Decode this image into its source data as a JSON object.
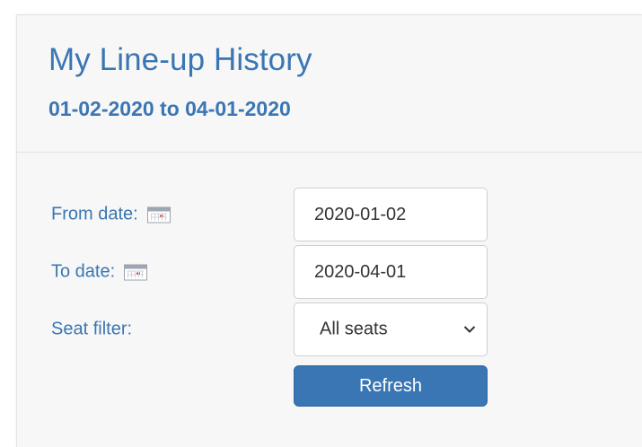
{
  "page": {
    "title": "My Line-up History",
    "subtitle": "01-02-2020 to 04-01-2020"
  },
  "filters": {
    "from_date": {
      "label": "From date:",
      "value": "2020-01-02",
      "icon": "calendar-icon"
    },
    "to_date": {
      "label": "To date:",
      "value": "2020-04-01",
      "icon": "calendar-icon"
    },
    "seat_filter": {
      "label": "Seat filter:",
      "selected": "All seats",
      "icon": "chevron-down-icon"
    }
  },
  "actions": {
    "refresh_label": "Refresh"
  },
  "colors": {
    "accent": "#3a76b3",
    "panel_background": "#f7f7f7",
    "field_border": "#cfcfcf",
    "button_text": "#ffffff"
  }
}
